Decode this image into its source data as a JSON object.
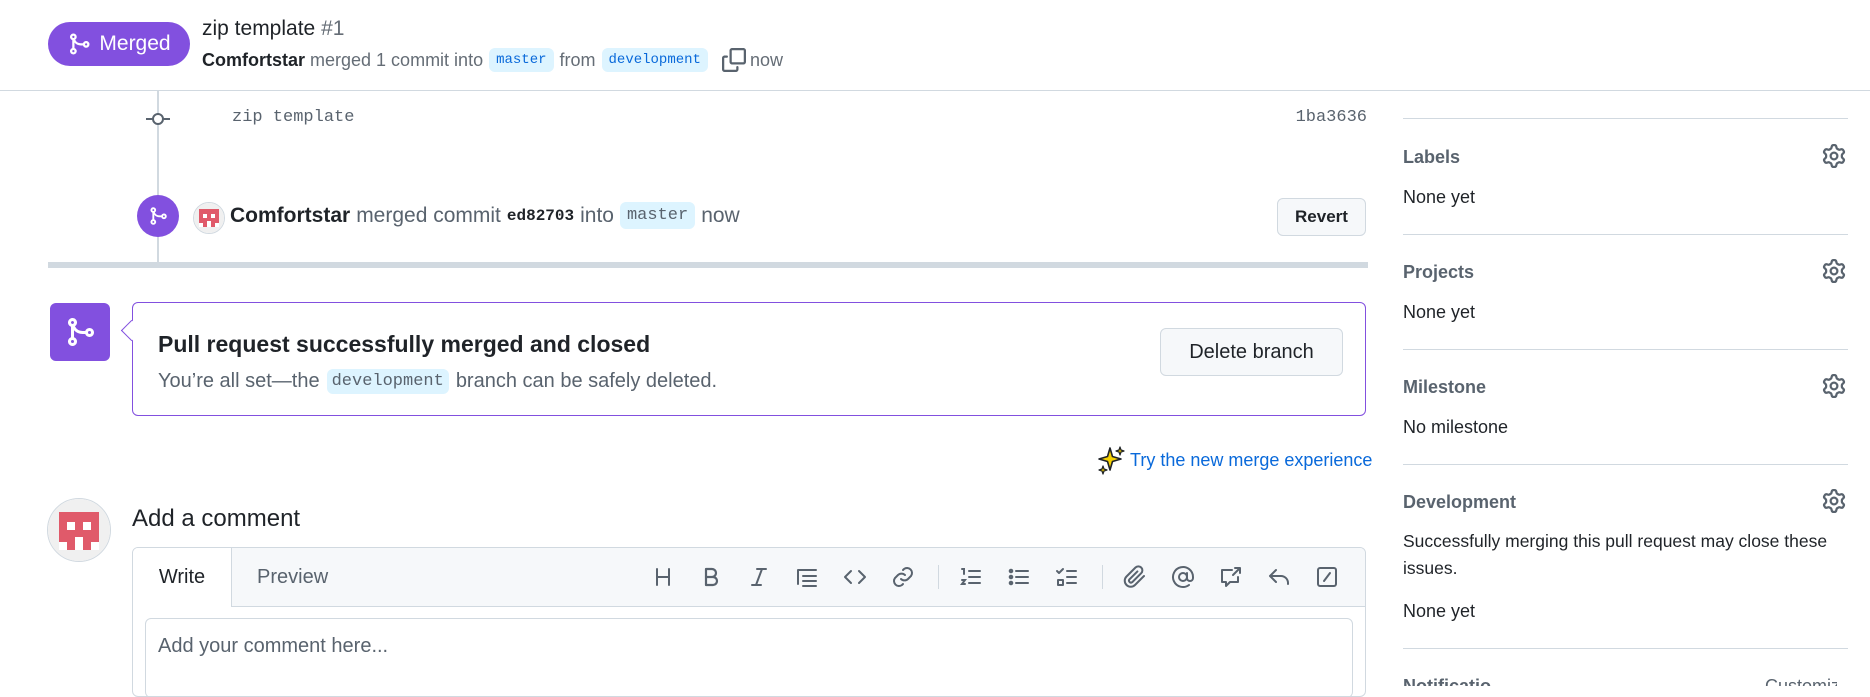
{
  "header": {
    "status_badge": "Merged",
    "title": "zip template",
    "number": "#1",
    "author": "Comfortstar",
    "merged_text": "merged 1 commit into",
    "base_branch": "master",
    "from_text": "from",
    "head_branch": "development",
    "time": "now"
  },
  "timeline": {
    "commit_message": "zip template",
    "commit_sha": "1ba3636",
    "merge_event": {
      "author": "Comfortstar",
      "action_text": "merged commit",
      "sha": "ed82703",
      "into_text": "into",
      "branch": "master",
      "time": "now",
      "revert_label": "Revert"
    }
  },
  "merge_box": {
    "title": "Pull request successfully merged and closed",
    "desc_before": "You’re all set—the",
    "branch": "development",
    "desc_after": "branch can be safely deleted.",
    "delete_label": "Delete branch"
  },
  "try_link": "Try the new merge experience",
  "comment": {
    "title": "Add a comment",
    "tab_write": "Write",
    "tab_preview": "Preview",
    "placeholder": "Add your comment here..."
  },
  "sidebar": {
    "labels": {
      "title": "Labels",
      "value": "None yet"
    },
    "projects": {
      "title": "Projects",
      "value": "None yet"
    },
    "milestone": {
      "title": "Milestone",
      "value": "No milestone"
    },
    "development": {
      "title": "Development",
      "description": "Successfully merging this pull request may close these issues.",
      "value": "None yet"
    },
    "notifications": {
      "title": "Notifications",
      "action": "Customize"
    }
  },
  "colors": {
    "merged": "#8250df",
    "link": "#0969da",
    "branch_bg": "#ddf4ff",
    "avatar": "#e05a6a"
  }
}
